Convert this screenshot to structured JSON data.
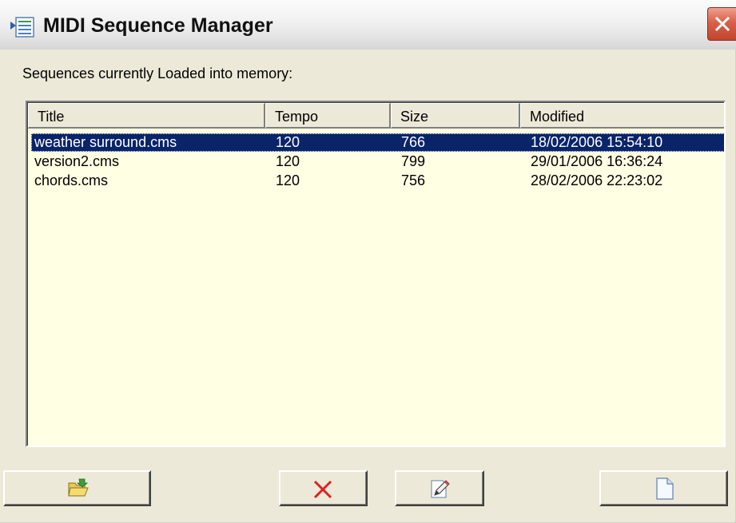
{
  "window": {
    "title": "MIDI Sequence Manager",
    "icon": "list-document-icon"
  },
  "prompt": "Sequences currently Loaded into memory:",
  "columns": [
    "Title",
    "Tempo",
    "Size",
    "Modified"
  ],
  "rows": [
    {
      "title": "weather surround.cms",
      "tempo": "120",
      "size": "766",
      "modified": "18/02/2006 15:54:10",
      "selected": true
    },
    {
      "title": "version2.cms",
      "tempo": "120",
      "size": "799",
      "modified": "29/01/2006 16:36:24",
      "selected": false
    },
    {
      "title": "chords.cms",
      "tempo": "120",
      "size": "756",
      "modified": "28/02/2006 22:23:02",
      "selected": false
    }
  ],
  "buttons": [
    {
      "name": "open-button",
      "icon": "open-folder-icon"
    },
    {
      "name": "delete-button",
      "icon": "red-x-icon"
    },
    {
      "name": "edit-button",
      "icon": "pencil-edit-icon"
    },
    {
      "name": "new-button",
      "icon": "blank-page-icon"
    }
  ],
  "colors": {
    "list_background": "#ffffe4",
    "selection": "#0a246a",
    "face": "#ece9d8"
  }
}
